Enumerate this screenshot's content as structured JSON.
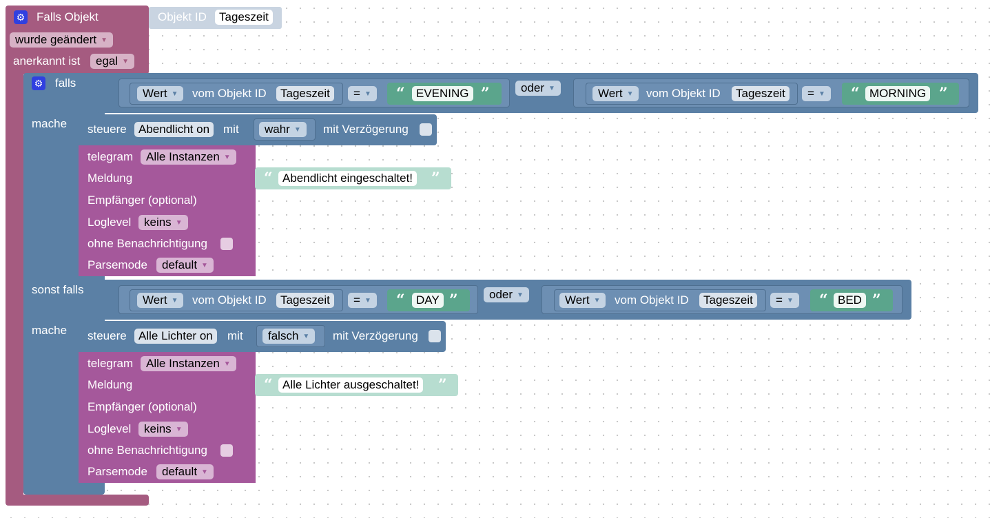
{
  "trigger": {
    "title": "Falls Objekt",
    "object_label": "Objekt ID",
    "object_value": "Tageszeit",
    "changed": "wurde geändert",
    "ack_label": "anerkannt ist",
    "ack_value": "egal"
  },
  "if_block": {
    "falls": "falls",
    "mache": "mache",
    "sonst_falls": "sonst falls",
    "mache2": "mache"
  },
  "cond1": {
    "left": {
      "wert": "Wert",
      "vom": "vom Objekt ID",
      "obj": "Tageszeit",
      "op": "=",
      "value": "EVENING"
    },
    "or": "oder",
    "right": {
      "wert": "Wert",
      "vom": "vom Objekt ID",
      "obj": "Tageszeit",
      "op": "=",
      "value": "MORNING"
    }
  },
  "cond2": {
    "left": {
      "wert": "Wert",
      "vom": "vom Objekt ID",
      "obj": "Tageszeit",
      "op": "=",
      "value": "DAY"
    },
    "or": "oder",
    "right": {
      "wert": "Wert",
      "vom": "vom Objekt ID",
      "obj": "Tageszeit",
      "op": "=",
      "value": "BED"
    }
  },
  "action1": {
    "steuere": "steuere",
    "target": "Abendlicht on",
    "mit": "mit",
    "value": "wahr",
    "delay": "mit Verzögerung"
  },
  "telegram1": {
    "telegram": "telegram",
    "instances": "Alle Instanzen",
    "meldung": "Meldung",
    "message": "Abendlicht eingeschaltet!",
    "empfaenger": "Empfänger (optional)",
    "loglevel": "Loglevel",
    "loglevel_value": "keins",
    "ohne": "ohne Benachrichtigung",
    "parsemode": "Parsemode",
    "parsemode_value": "default"
  },
  "action2": {
    "steuere": "steuere",
    "target": "Alle Lichter on",
    "mit": "mit",
    "value": "falsch",
    "delay": "mit Verzögerung"
  },
  "telegram2": {
    "telegram": "telegram",
    "instances": "Alle Instanzen",
    "meldung": "Meldung",
    "message": "Alle Lichter ausgeschaltet!",
    "empfaenger": "Empfänger (optional)",
    "loglevel": "Loglevel",
    "loglevel_value": "keins",
    "ohne": "ohne Benachrichtigung",
    "parsemode": "Parsemode",
    "parsemode_value": "default"
  },
  "icons": {
    "gear": "gear-icon",
    "dropdown": "dropdown-arrow-icon",
    "quote_open": "quote-open-icon",
    "quote_close": "quote-close-icon"
  },
  "colors": {
    "event": "#a55b80",
    "logic": "#5b80a5",
    "telegram": "#a5589b",
    "text": "#5ba58c"
  }
}
